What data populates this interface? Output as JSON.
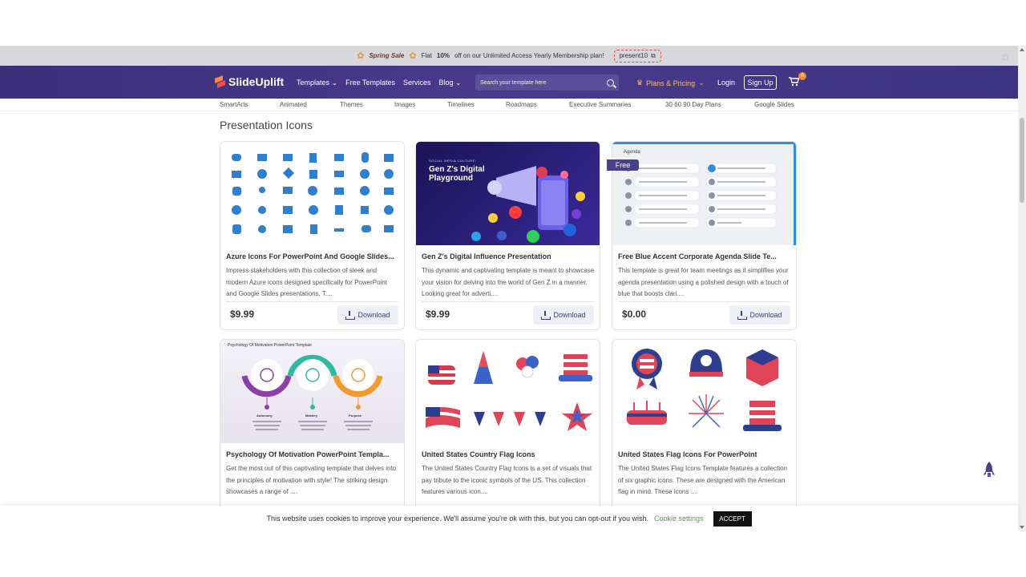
{
  "promo": {
    "sale": "Spring Sale",
    "text_prefix": "Flat",
    "percent": "10%",
    "text_suffix": "off on our Unlimited Access Yearly Membership plan!",
    "coupon": "present10"
  },
  "header": {
    "logo": "SlideUplift",
    "nav": [
      "Templates",
      "Free Templates",
      "Services",
      "Blog"
    ],
    "search_placeholder": "Search your template here",
    "plans": "Plans & Pricing",
    "login": "Login",
    "signup": "Sign Up",
    "cart_count": "0"
  },
  "subnav": [
    "SmartArts",
    "Animated",
    "Themes",
    "Images",
    "Timelines",
    "Roadmaps",
    "Executive Summaries",
    "30 60 90 Day Plans",
    "Google Slides"
  ],
  "main": {
    "section_title": "Presentation Icons",
    "download_label": "Download",
    "free_badge": "Free",
    "cards": [
      {
        "title": "Azure Icons For PowerPoint And Google Slides...",
        "desc": "Impress stakeholders with this collection of sleek and modern Azure icons designed specifically for PowerPoint and Google Slides presentations. T....",
        "price": "$9.99"
      },
      {
        "title": "Gen Z's Digital Influence Presentation",
        "desc": "This dynamic and captivating template is meant to showcase your vision for delving into the world of Gen Z in a manner. Looking great for adverti....",
        "price": "$9.99",
        "thumb_kicker": "SOCIAL MEDIA CULTURE:",
        "thumb_title": "Gen Z's Digital Playground"
      },
      {
        "title": "Free Blue Accent Corporate Agenda Slide Te...",
        "desc": "This template is great for team meetings as it simplifies your agenda presentation using a polished design with a touch of blue that boosts clari....",
        "price": "$0.00",
        "thumb_heading": "Agenda"
      },
      {
        "title": "Psychology Of Motivation PowerPoint Templa...",
        "desc": "Get the most out of this captivating template that delves into the principles of motivation with style! The striking design showcases a range of ....",
        "thumb_heading": "Psychology Of Motivation PowerPoint Template",
        "thumb_labels": [
          "Autonomy",
          "Mastery",
          "Purpose"
        ]
      },
      {
        "title": "United States Country Flag Icons",
        "desc": "The United States Country Flag Icons is a set of visuals that pay tribute to the iconic symbols of the US. This collection features various icon...."
      },
      {
        "title": "United States Flag Icons For PowerPoint",
        "desc": "The United States Flag Icons Template features a collection of six graphic icons. These are designed with the American flag in mind. These icons ...."
      }
    ]
  },
  "cookie": {
    "text": "This website uses cookies to improve your experience. We'll assume you're ok with this, but you can opt-out if you wish.",
    "settings": "Cookie settings",
    "accept": "ACCEPT"
  }
}
